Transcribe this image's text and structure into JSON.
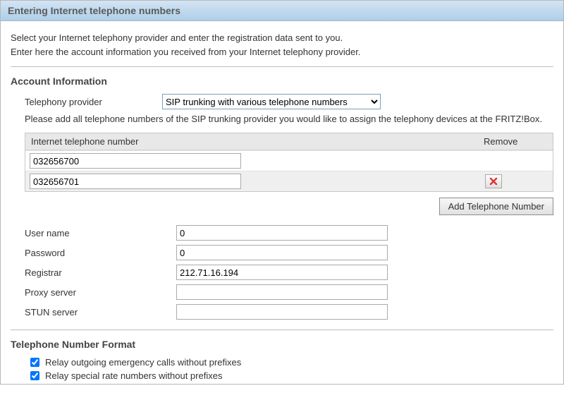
{
  "titleBar": "Entering Internet telephone numbers",
  "intro": {
    "line1": "Select your Internet telephony provider and enter the registration data sent to you.",
    "line2": "Enter here the account information you received from your Internet telephony provider."
  },
  "accountSection": {
    "title": "Account Information",
    "providerLabel": "Telephony provider",
    "providerValue": "SIP trunking with various telephone numbers",
    "helpText": "Please add all telephone numbers of the SIP trunking provider you would like to assign the telephony devices at the FRITZ!Box.",
    "tableHead": {
      "number": "Internet telephone number",
      "remove": "Remove"
    },
    "numbers": [
      "032656700",
      "032656701"
    ],
    "addButton": "Add Telephone Number",
    "fields": {
      "usernameLabel": "User name",
      "usernameValue": "0",
      "passwordLabel": "Password",
      "passwordValue": "0",
      "registrarLabel": "Registrar",
      "registrarValue": "212.71.16.194",
      "proxyLabel": "Proxy server",
      "proxyValue": "",
      "stunLabel": "STUN server",
      "stunValue": ""
    }
  },
  "formatSection": {
    "title": "Telephone Number Format",
    "opt1": "Relay outgoing emergency calls without prefixes",
    "opt2": "Relay special rate numbers without prefixes"
  }
}
